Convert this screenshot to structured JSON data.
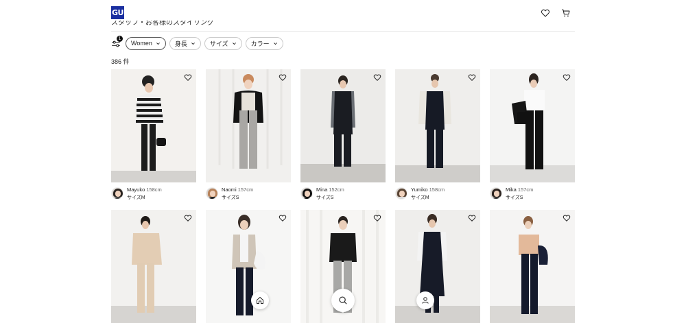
{
  "header": {
    "logo_text": "GU",
    "subtitle": "スタッフ・お客様のスタイリング",
    "icons": [
      "heart-icon",
      "cart-icon"
    ]
  },
  "filters": {
    "badge_count": "1",
    "chips": [
      "Women",
      "身長",
      "サイズ",
      "カラー"
    ]
  },
  "result_count": "386 件",
  "models": [
    {
      "name": "Mayuko",
      "height": "158cm",
      "size": "サイズM"
    },
    {
      "name": "Naomi",
      "height": "157cm",
      "size": "サイズS"
    },
    {
      "name": "Mina",
      "height": "152cm",
      "size": "サイズS"
    },
    {
      "name": "Yumiko",
      "height": "158cm",
      "size": "サイズM"
    },
    {
      "name": "Mika",
      "height": "157cm",
      "size": "サイズS"
    }
  ],
  "colors": {
    "logo_bg": "#1a2fa0",
    "text": "#222222"
  },
  "bottom_nav": [
    "home-icon",
    "search-icon",
    "user-icon"
  ]
}
